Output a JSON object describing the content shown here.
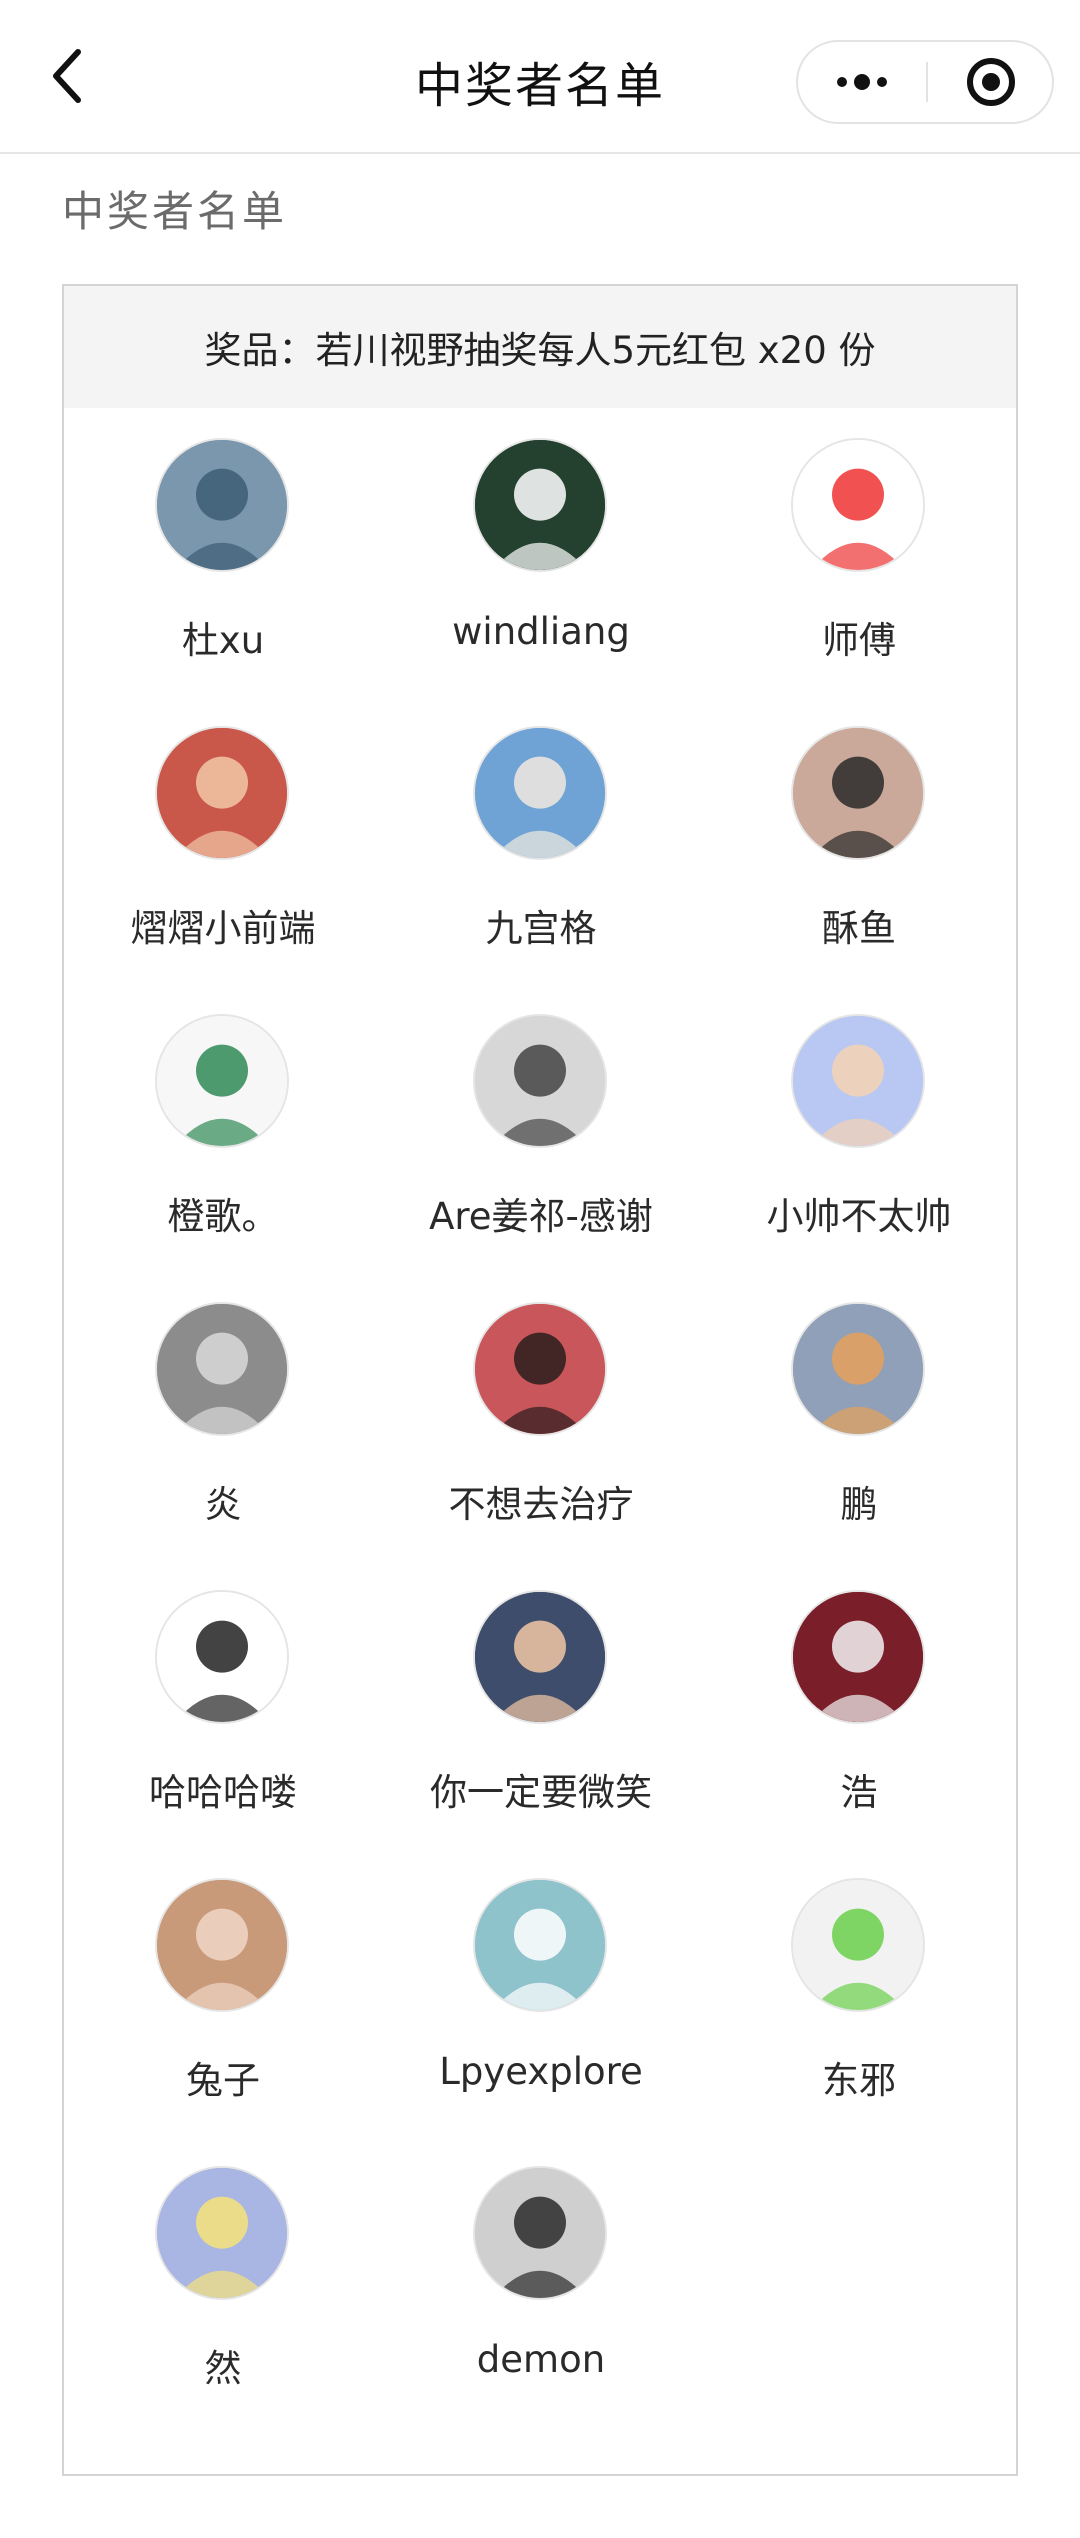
{
  "nav": {
    "title": "中奖者名单"
  },
  "section_label": "中奖者名单",
  "prize": "奖品：若川视野抽奖每人5元红包 x20 份",
  "winners": [
    {
      "name": "杜xu",
      "avatar": "street-rain-photo",
      "bg": "#7a97ad",
      "fg": "#3d5d74"
    },
    {
      "name": "windliang",
      "avatar": "ink-splash-portrait",
      "bg": "#24402f",
      "fg": "#ffffff"
    },
    {
      "name": "师傅",
      "avatar": "cartoon-boy",
      "bg": "#ffffff",
      "fg": "#e33"
    },
    {
      "name": "熠熠小前端",
      "avatar": "anime-redhair-boy",
      "bg": "#c9584a",
      "fg": "#f2c7a6"
    },
    {
      "name": "九宫格",
      "avatar": "anime-sky-boy",
      "bg": "#6fa3d6",
      "fg": "#f1e9de"
    },
    {
      "name": "酥鱼",
      "avatar": "woman-profile",
      "bg": "#caa89a",
      "fg": "#2a2a2a"
    },
    {
      "name": "橙歌。",
      "avatar": "cartoon-kid-grid",
      "bg": "#f7f7f7",
      "fg": "#2e8a55"
    },
    {
      "name": "Are姜祁-感谢",
      "avatar": "bw-man-portrait",
      "bg": "#d7d7d7",
      "fg": "#444"
    },
    {
      "name": "小帅不太帅",
      "avatar": "crayon-shin-chan",
      "bg": "#b9c8f2",
      "fg": "#f5d2b4"
    },
    {
      "name": "炎",
      "avatar": "tunnel-photo",
      "bg": "#8c8c8c",
      "fg": "#d9d9d9"
    },
    {
      "name": "不想去治疗",
      "avatar": "man-red-bg",
      "bg": "#c9565a",
      "fg": "#2a1d1d"
    },
    {
      "name": "鹏",
      "avatar": "anime-sparkler",
      "bg": "#8fa0b8",
      "fg": "#e6a15a"
    },
    {
      "name": "哈哈哈喽",
      "avatar": "meme-face",
      "bg": "#ffffff",
      "fg": "#222"
    },
    {
      "name": "你一定要微笑",
      "avatar": "cartoon-boy-3d",
      "bg": "#3e4d6b",
      "fg": "#f2c8a4"
    },
    {
      "name": "浩",
      "avatar": "hand-cat",
      "bg": "#7a1e2a",
      "fg": "#f3f3f3"
    },
    {
      "name": "兔子",
      "avatar": "girl-bunny-ears",
      "bg": "#c99a7a",
      "fg": "#f0d6c6"
    },
    {
      "name": "Lpyexplore",
      "avatar": "cat-computer",
      "bg": "#8ec3cc",
      "fg": "#ffffff"
    },
    {
      "name": "东邪",
      "avatar": "green-jacket-muscle",
      "bg": "#f2f2f2",
      "fg": "#6ad04a"
    },
    {
      "name": "然",
      "avatar": "baby-duck-meme",
      "bg": "#a9b5e3",
      "fg": "#f7e37a"
    },
    {
      "name": "demon",
      "avatar": "bw-man-back",
      "bg": "#cfcfcf",
      "fg": "#2a2a2a"
    }
  ]
}
